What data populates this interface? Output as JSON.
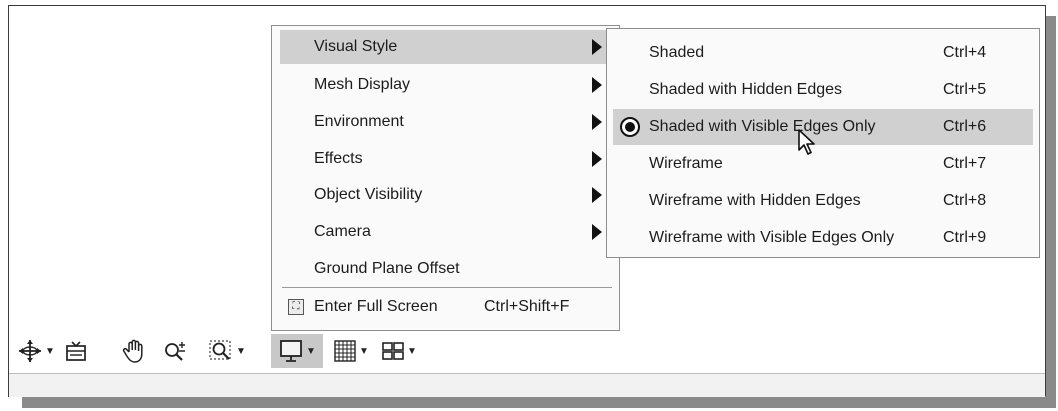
{
  "context_menu": {
    "items": [
      {
        "label": "Visual Style",
        "has_submenu": true,
        "highlighted": true
      },
      {
        "label": "Mesh Display",
        "has_submenu": true
      },
      {
        "label": "Environment",
        "has_submenu": true
      },
      {
        "label": "Effects",
        "has_submenu": true
      },
      {
        "label": "Object Visibility",
        "has_submenu": true
      },
      {
        "label": "Camera",
        "has_submenu": true
      },
      {
        "label": "Ground Plane Offset",
        "has_submenu": false
      }
    ],
    "full_screen": {
      "label": "Enter Full Screen",
      "shortcut": "Ctrl+Shift+F",
      "icon": "fullscreen-icon"
    }
  },
  "visual_style_submenu": {
    "items": [
      {
        "label": "Shaded",
        "shortcut": "Ctrl+4"
      },
      {
        "label": "Shaded with Hidden Edges",
        "shortcut": "Ctrl+5"
      },
      {
        "label": "Shaded with Visible Edges Only",
        "shortcut": "Ctrl+6",
        "selected": true
      },
      {
        "label": "Wireframe",
        "shortcut": "Ctrl+7"
      },
      {
        "label": "Wireframe with Hidden Edges",
        "shortcut": "Ctrl+8"
      },
      {
        "label": "Wireframe with Visible Edges Only",
        "shortcut": "Ctrl+9"
      }
    ]
  },
  "navigation_toolbar": {
    "tools": [
      "orbit-icon",
      "look-at-icon",
      "pan-icon",
      "zoom-icon",
      "zoom-window-icon",
      "display-settings-icon",
      "grid-icon",
      "viewport-layout-icon"
    ],
    "active_tool": "display-settings-icon"
  }
}
